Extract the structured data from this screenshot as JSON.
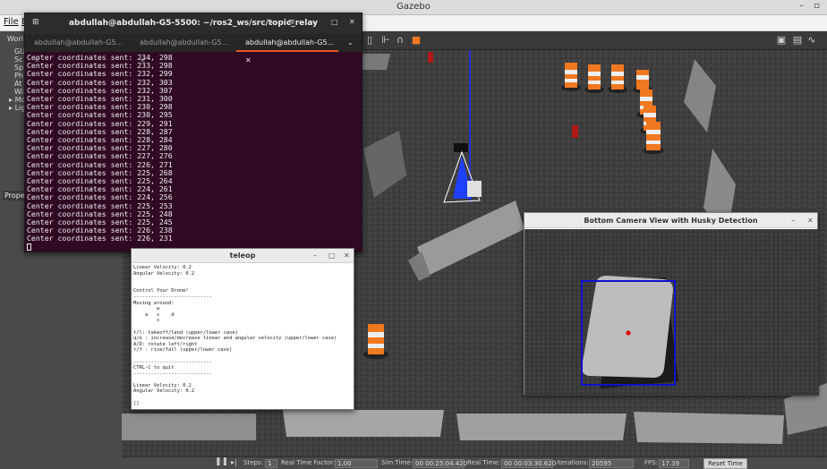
{
  "gazebo": {
    "title": "Gazebo",
    "menu": [
      "File",
      "E"
    ],
    "left_panel": {
      "tab": "Worl",
      "items": [
        "GU",
        "Sc",
        "Sp",
        "Ph",
        "At",
        "Wi",
        "Mo",
        "Lig"
      ],
      "properties": "Prope"
    },
    "bottom_bar": {
      "steps_label": "Steps:",
      "steps_value": "1",
      "rtf_label": "Real Time Factor:",
      "rtf_value": "1.00",
      "sim_time_label": "Sim Time:",
      "sim_time_value": "00 00:25:04.420",
      "real_time_label": "Real Time:",
      "real_time_value": "00 00:03:30.620",
      "iterations_label": "Iterations:",
      "iterations_value": "20595",
      "fps_label": "FPS:",
      "fps_value": "17.39",
      "reset_label": "Reset Time"
    }
  },
  "terminal": {
    "title": "abdullah@abdullah-G5-5500: ~/ros2_ws/src/topic_relay",
    "tabs": [
      "abdullah@abdullah-G5...",
      "abdullah@abdullah-G5...",
      "abdullah@abdullah-G5..."
    ],
    "active_tab": 2,
    "lines": [
      "Center coordinates sent: 234, 298",
      "Center coordinates sent: 233, 298",
      "Center coordinates sent: 232, 299",
      "Center coordinates sent: 232, 303",
      "Center coordinates sent: 232, 307",
      "Center coordinates sent: 231, 300",
      "Center coordinates sent: 230, 298",
      "Center coordinates sent: 230, 295",
      "Center coordinates sent: 229, 291",
      "Center coordinates sent: 228, 287",
      "Center coordinates sent: 228, 284",
      "Center coordinates sent: 227, 280",
      "Center coordinates sent: 227, 276",
      "Center coordinates sent: 226, 271",
      "Center coordinates sent: 225, 268",
      "Center coordinates sent: 225, 264",
      "Center coordinates sent: 224, 261",
      "Center coordinates sent: 224, 256",
      "Center coordinates sent: 225, 253",
      "Center coordinates sent: 225, 248",
      "Center coordinates sent: 225, 245",
      "Center coordinates sent: 226, 238",
      "Center coordinates sent: 226, 231"
    ]
  },
  "teleop": {
    "title": "teleop",
    "lines": [
      "Linear Velocity: 0.2",
      "Angular Velocity: 0.2",
      "",
      "",
      "Control Your Drone!",
      "---------------------------",
      "Moving around:",
      "        w",
      "    a   s    d",
      "        x",
      "",
      "t/l: takeoff/land (upper/lower case)",
      "q/e : increase/decrease linear and angular velocity (upper/lower case)",
      "A/D: rotate left/right",
      "r/f : rise/fall (upper/lower case)",
      "",
      "---------------------------",
      "CTRL-C to quit",
      "---------------------------",
      "",
      "Linear Velocity: 0.2",
      "Angular Velocity: 0.2",
      "",
      "[]"
    ]
  },
  "camera": {
    "title": "Bottom Camera View with Husky Detection",
    "box_color": "#1010d0",
    "center_color": "#e00000"
  },
  "colors": {
    "terminal_bg": "#300a24",
    "accent": "#e95420"
  }
}
